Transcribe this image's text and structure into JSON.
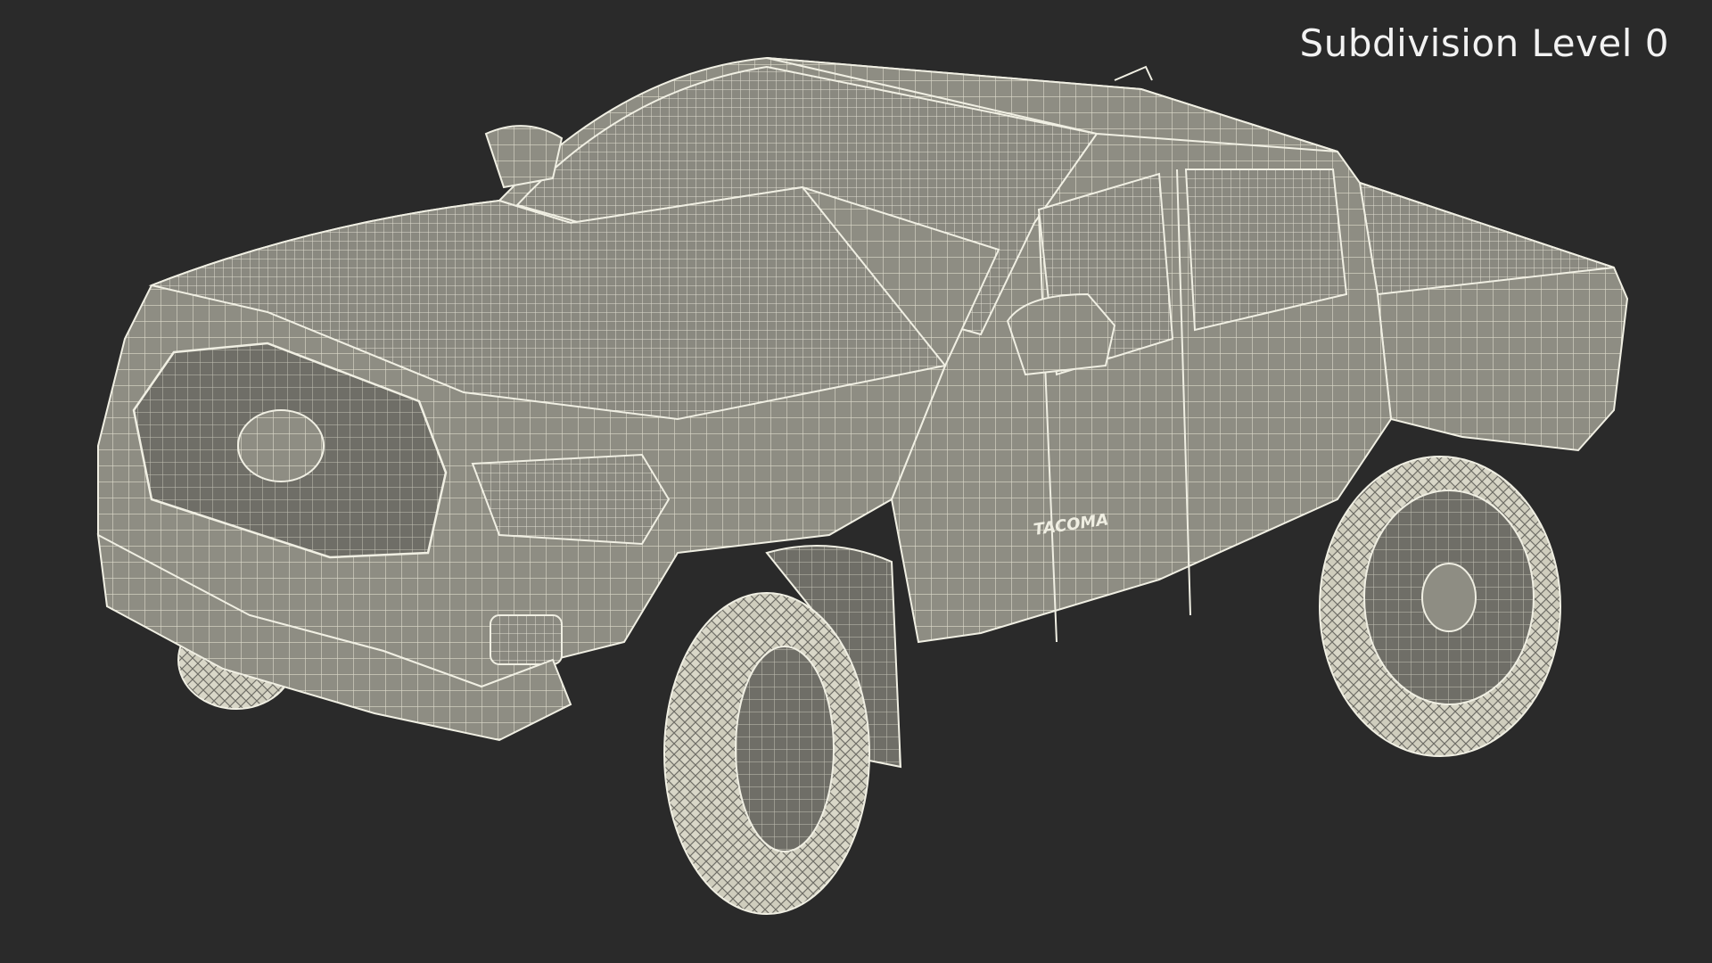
{
  "viewport": {
    "background": "#2a2a2a",
    "wire_color": "#e6e4d4",
    "surface_color": "#8f8e84"
  },
  "overlay": {
    "label": "Subdivision Level 0"
  },
  "model": {
    "badge_text": "TACOMA"
  }
}
